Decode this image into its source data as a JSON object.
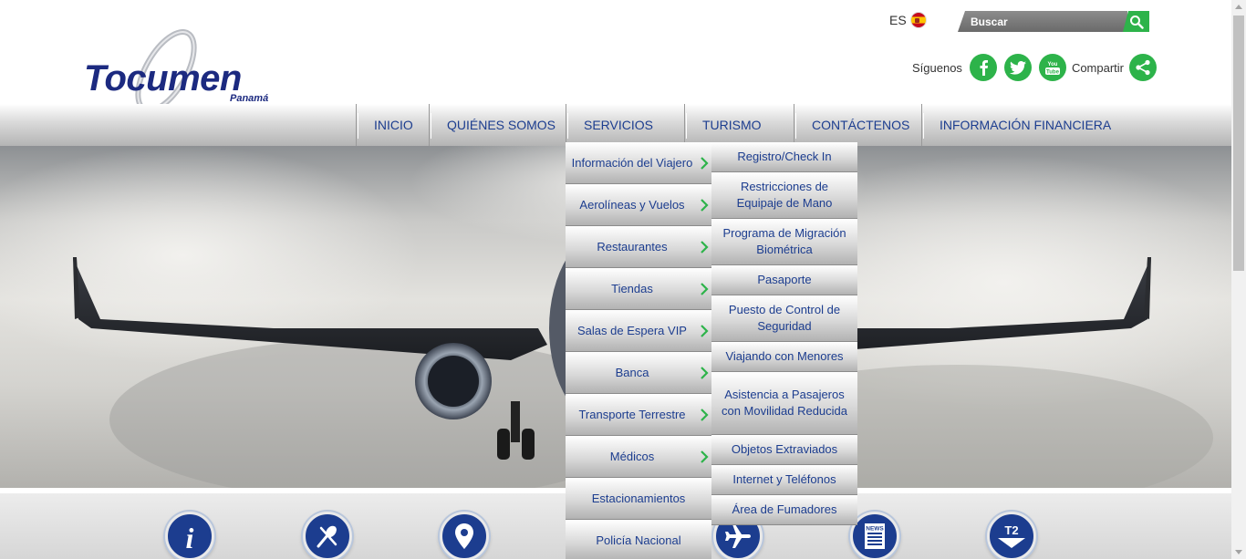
{
  "header": {
    "logo_text": "Tocumen",
    "logo_sub": "Panamá",
    "lang_label": "ES",
    "search_placeholder": "Buscar",
    "follow_label": "Síguenos",
    "share_label": "Compartir"
  },
  "nav": {
    "items": [
      {
        "label": "INICIO"
      },
      {
        "label": "QUIÉNES SOMOS"
      },
      {
        "label": "SERVICIOS"
      },
      {
        "label": "TURISMO"
      },
      {
        "label": "CONTÁCTENOS"
      },
      {
        "label": "INFORMACIÓN FINANCIERA"
      }
    ]
  },
  "services_menu": {
    "items": [
      {
        "label": "Información del Viajero"
      },
      {
        "label": "Aerolíneas y Vuelos"
      },
      {
        "label": "Restaurantes"
      },
      {
        "label": "Tiendas"
      },
      {
        "label": "Salas de Espera VIP"
      },
      {
        "label": "Banca"
      },
      {
        "label": "Transporte Terrestre"
      },
      {
        "label": "Médicos"
      },
      {
        "label": "Estacionamientos"
      },
      {
        "label": "Policía Nacional"
      }
    ]
  },
  "traveler_submenu": {
    "items": [
      {
        "label": "Registro/Check In"
      },
      {
        "label": "Restricciones de Equipaje de Mano"
      },
      {
        "label": "Programa de Migración Biométrica"
      },
      {
        "label": "Pasaporte"
      },
      {
        "label": "Puesto de Control de Seguridad"
      },
      {
        "label": "Viajando con Menores"
      },
      {
        "label": "Asistencia a Pasajeros con Movilidad Reducida"
      },
      {
        "label": "Objetos Extraviados"
      },
      {
        "label": "Internet y Teléfonos"
      },
      {
        "label": "Área de Fumadores"
      }
    ]
  },
  "quick_links": {
    "news_label": "NEWS",
    "t2_label": "T2"
  },
  "colors": {
    "brand_blue": "#1c3d8f",
    "accent_green": "#2db34a"
  }
}
